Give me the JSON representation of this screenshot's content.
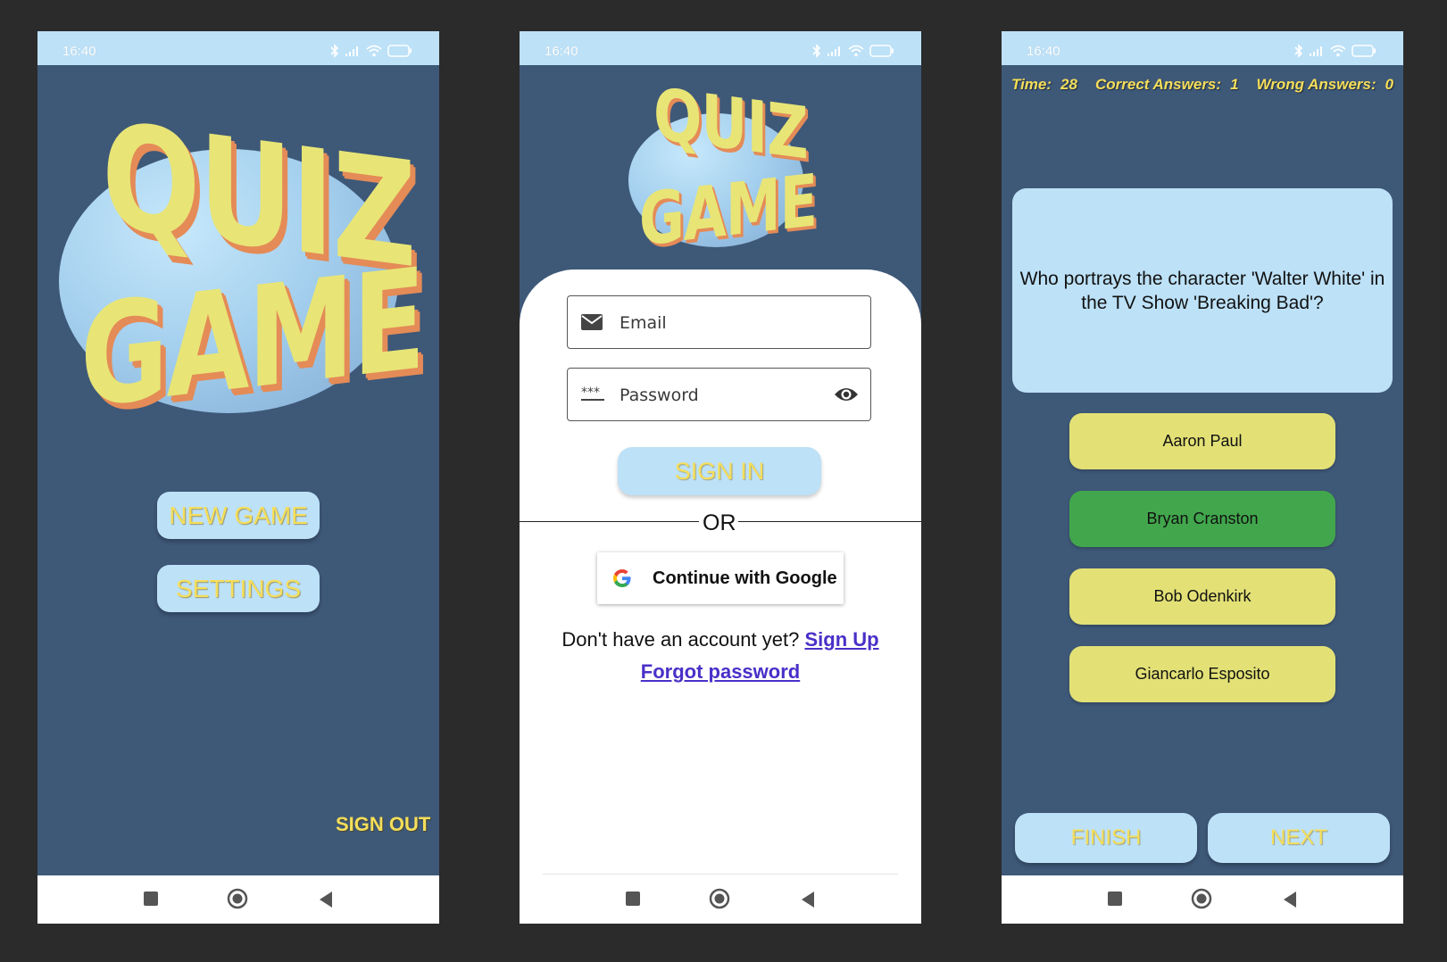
{
  "status": {
    "time": "16:40",
    "battery": "64"
  },
  "home": {
    "logo_line1": "QUIZ",
    "logo_line2": "GAME",
    "new_game_label": "NEW GAME",
    "settings_label": "SETTINGS",
    "sign_out_label": "SIGN OUT"
  },
  "login": {
    "logo_line1": "QUIZ",
    "logo_line2": "GAME",
    "email_placeholder": "Email",
    "password_placeholder": "Password",
    "sign_in_label": "SIGN IN",
    "or_text": "OR",
    "google_label": "Continue with Google",
    "no_account_text": "Don't have an account yet?",
    "sign_up_link": "Sign Up",
    "forgot_link": "Forgot password"
  },
  "game": {
    "time_label": "Time:",
    "time_value": "28",
    "correct_label": "Correct Answers:",
    "correct_value": "1",
    "wrong_label": "Wrong Answers:",
    "wrong_value": "0",
    "question": "Who portrays the character 'Walter White' in the TV Show 'Breaking Bad'?",
    "answers": [
      "Aaron Paul",
      "Bryan Cranston",
      "Bob Odenkirk",
      "Giancarlo Esposito"
    ],
    "finish_label": "FINISH",
    "next_label": "NEXT"
  },
  "colors": {
    "background": "#3e5878",
    "status_bar": "#bde1f7",
    "button_blue": "#bde1f7",
    "button_text_yellow": "#f5de5a",
    "answer_yellow": "#e3e176",
    "answer_correct_green": "#41a64c",
    "link_purple": "#4a2fc8"
  },
  "icons": {
    "status": [
      "bluetooth-icon",
      "signal-icon",
      "wifi-icon",
      "battery-icon"
    ],
    "nav": [
      "recent-apps-icon",
      "home-icon",
      "back-icon"
    ],
    "fields": [
      "mail-icon",
      "password-icon",
      "eye-icon"
    ],
    "google": "google-logo-icon"
  }
}
